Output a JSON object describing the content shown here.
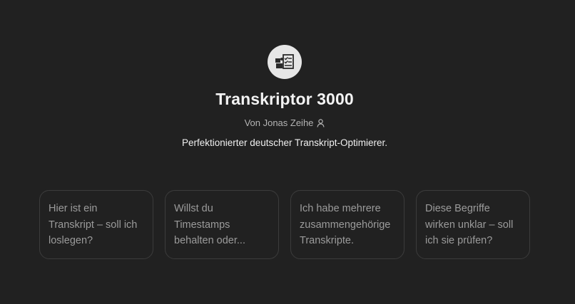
{
  "gpt": {
    "icon": "checklist-gears-icon",
    "name": "Transkriptor 3000",
    "author": "Von Jonas Zeihe",
    "author_icon": "person-icon",
    "description": "Perfektionierter deutscher Transkript-Optimierer."
  },
  "conversation_starters": [
    {
      "label": "Hier ist ein Transkript – soll ich loslegen?"
    },
    {
      "label": "Willst du Timestamps behalten oder..."
    },
    {
      "label": "Ich habe mehrere zusammengehörige Transkripte."
    },
    {
      "label": "Diese Begriffe wirken unklar – soll ich sie prüfen?"
    }
  ],
  "colors": {
    "background": "#212121",
    "avatar_bg": "#e6e6e6",
    "card_border": "#3c3c3c",
    "muted_text": "#9b9b9b"
  }
}
